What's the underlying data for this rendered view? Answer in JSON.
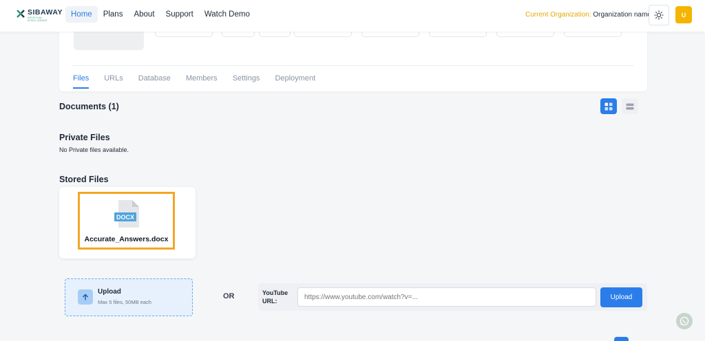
{
  "header": {
    "logo": {
      "brand": "SIBAWAY",
      "tagline": "ARTIFICIAL INTELLIGENCE"
    },
    "nav": [
      {
        "label": "Home",
        "active": true
      },
      {
        "label": "Plans",
        "active": false
      },
      {
        "label": "About",
        "active": false
      },
      {
        "label": "Support",
        "active": false
      },
      {
        "label": "Watch Demo",
        "active": false
      }
    ],
    "org_label": "Current Organization:",
    "org_name": "Organization name",
    "theme_icon": "sun-icon",
    "avatar_initial": "U"
  },
  "tabs": [
    {
      "label": "Files",
      "active": true
    },
    {
      "label": "URLs",
      "active": false
    },
    {
      "label": "Database",
      "active": false
    },
    {
      "label": "Members",
      "active": false
    },
    {
      "label": "Settings",
      "active": false
    },
    {
      "label": "Deployment",
      "active": false
    }
  ],
  "documents": {
    "title": "Documents (1)",
    "view_grid_icon": "grid-view-icon",
    "view_list_icon": "list-view-icon"
  },
  "private_files": {
    "title": "Private Files",
    "empty": "No Private files available."
  },
  "stored_files": {
    "title": "Stored Files",
    "items": [
      {
        "name": "Accurate_Answers.docx",
        "type": "DOCX"
      }
    ]
  },
  "upload": {
    "title": "Upload",
    "subtitle": "Max 5 files, 50MB each",
    "or": "OR",
    "youtube_label": "YouTube URL:",
    "youtube_placeholder": "https://www.youtube.com/watch?v=...",
    "button": "Upload"
  },
  "colors": {
    "accent": "#2b7de9",
    "highlight": "#f5a623",
    "org_label": "#e6a800"
  }
}
